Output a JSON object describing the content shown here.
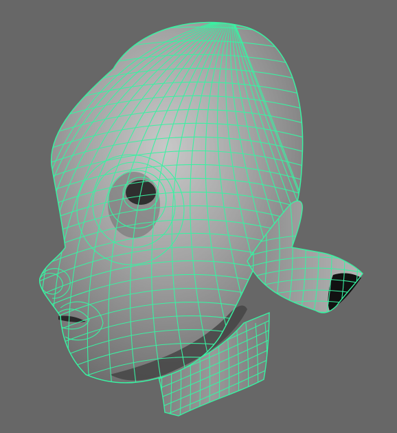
{
  "viewport": {
    "background": "#676767",
    "wireframe_color": "#39f2a2",
    "shaded_base": "#8c8c8c",
    "shaded_light": "#c9c9c9",
    "shaded_dark": "#4a4a4a",
    "object": "head-mesh",
    "display_mode": "wireframe-on-shaded",
    "selected": true
  }
}
